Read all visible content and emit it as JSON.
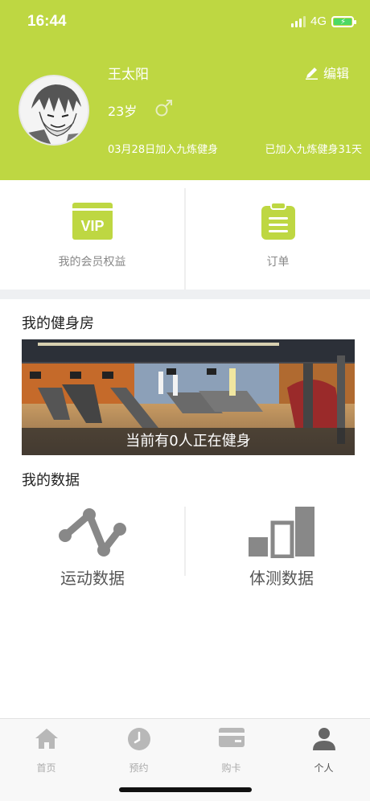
{
  "status_bar": {
    "time": "16:44",
    "network": "4G"
  },
  "profile": {
    "name": "王太阳",
    "edit_label": "编辑",
    "age": "23岁",
    "join_date": "03月28日加入九炼健身",
    "join_days": "已加入九炼健身31天"
  },
  "quick_actions": [
    {
      "label": "我的会员权益",
      "icon": "vip-card-icon",
      "badge": "VIP"
    },
    {
      "label": "订单",
      "icon": "clipboard-icon"
    }
  ],
  "gym": {
    "title": "我的健身房",
    "caption": "当前有0人正在健身"
  },
  "my_data": {
    "title": "我的数据",
    "items": [
      {
        "label": "运动数据",
        "icon": "line-chart-icon"
      },
      {
        "label": "体测数据",
        "icon": "bar-chart-icon"
      }
    ]
  },
  "tabbar": [
    {
      "label": "首页",
      "icon": "home-icon",
      "active": false
    },
    {
      "label": "预约",
      "icon": "clock-icon",
      "active": false
    },
    {
      "label": "购卡",
      "icon": "card-icon",
      "active": false
    },
    {
      "label": "个人",
      "icon": "person-icon",
      "active": true
    }
  ],
  "colors": {
    "accent": "#bed742",
    "icon_gray": "#888888",
    "tab_gray": "#b8b8b8"
  }
}
